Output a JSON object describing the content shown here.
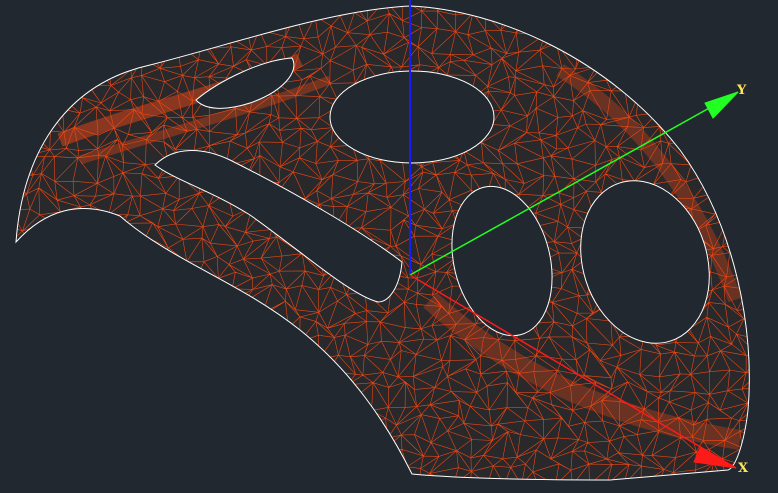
{
  "viewport": {
    "background": "#212830",
    "mesh_color": "#ff4a12",
    "edge_color": "#ffffff"
  },
  "axes": {
    "x": {
      "label": "X",
      "color": "#ff1a1a",
      "label_color": "#ffe55a"
    },
    "y": {
      "label": "Y",
      "color": "#22ff22",
      "label_color": "#ffe55a"
    },
    "z": {
      "label": "",
      "color": "#1a1aff"
    }
  }
}
